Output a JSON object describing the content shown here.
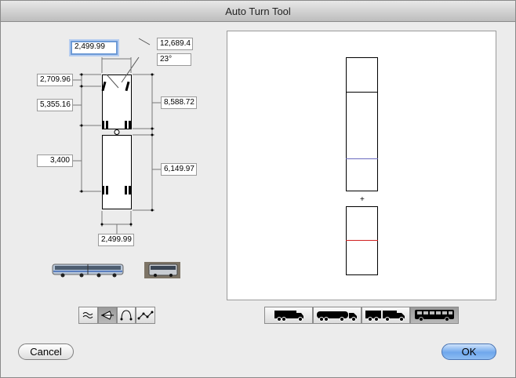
{
  "window": {
    "title": "Auto Turn Tool"
  },
  "dimensions": {
    "front_width": "2,499.99",
    "turn_radius": "12,689.4",
    "steer_angle": "23°",
    "front_overhang": "2,709.96",
    "front_wheelbase": "5,355.16",
    "front_length": "8,588.72",
    "rear_offset": "3,400",
    "rear_length": "6,149.97",
    "rear_width": "2,499.99"
  },
  "vehicle_thumbnails": [
    {
      "icon": "articulated-bus-photo-icon"
    },
    {
      "icon": "bus-front-photo-icon"
    }
  ],
  "path_modes": [
    {
      "icon": "wave-path-icon",
      "selected": false
    },
    {
      "icon": "steer-wheel-path-icon",
      "selected": true
    },
    {
      "icon": "arc-path-icon",
      "selected": false
    },
    {
      "icon": "polyline-path-icon",
      "selected": false
    }
  ],
  "vehicle_types": [
    {
      "icon": "truck-icon",
      "selected": false
    },
    {
      "icon": "tanker-truck-icon",
      "selected": false
    },
    {
      "icon": "truck-trailer-icon",
      "selected": false
    },
    {
      "icon": "bus-icon",
      "selected": true
    }
  ],
  "buttons": {
    "cancel": "Cancel",
    "ok": "OK"
  }
}
